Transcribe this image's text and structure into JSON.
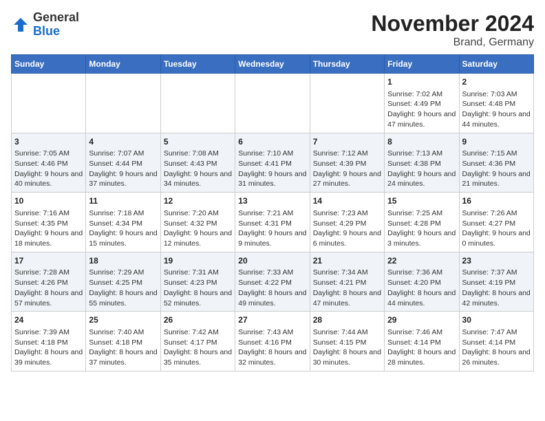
{
  "app": {
    "logo_general": "General",
    "logo_blue": "Blue"
  },
  "header": {
    "title": "November 2024",
    "subtitle": "Brand, Germany"
  },
  "weekdays": [
    "Sunday",
    "Monday",
    "Tuesday",
    "Wednesday",
    "Thursday",
    "Friday",
    "Saturday"
  ],
  "weeks": [
    [
      {
        "day": "",
        "info": ""
      },
      {
        "day": "",
        "info": ""
      },
      {
        "day": "",
        "info": ""
      },
      {
        "day": "",
        "info": ""
      },
      {
        "day": "",
        "info": ""
      },
      {
        "day": "1",
        "info": "Sunrise: 7:02 AM\nSunset: 4:49 PM\nDaylight: 9 hours and 47 minutes."
      },
      {
        "day": "2",
        "info": "Sunrise: 7:03 AM\nSunset: 4:48 PM\nDaylight: 9 hours and 44 minutes."
      }
    ],
    [
      {
        "day": "3",
        "info": "Sunrise: 7:05 AM\nSunset: 4:46 PM\nDaylight: 9 hours and 40 minutes."
      },
      {
        "day": "4",
        "info": "Sunrise: 7:07 AM\nSunset: 4:44 PM\nDaylight: 9 hours and 37 minutes."
      },
      {
        "day": "5",
        "info": "Sunrise: 7:08 AM\nSunset: 4:43 PM\nDaylight: 9 hours and 34 minutes."
      },
      {
        "day": "6",
        "info": "Sunrise: 7:10 AM\nSunset: 4:41 PM\nDaylight: 9 hours and 31 minutes."
      },
      {
        "day": "7",
        "info": "Sunrise: 7:12 AM\nSunset: 4:39 PM\nDaylight: 9 hours and 27 minutes."
      },
      {
        "day": "8",
        "info": "Sunrise: 7:13 AM\nSunset: 4:38 PM\nDaylight: 9 hours and 24 minutes."
      },
      {
        "day": "9",
        "info": "Sunrise: 7:15 AM\nSunset: 4:36 PM\nDaylight: 9 hours and 21 minutes."
      }
    ],
    [
      {
        "day": "10",
        "info": "Sunrise: 7:16 AM\nSunset: 4:35 PM\nDaylight: 9 hours and 18 minutes."
      },
      {
        "day": "11",
        "info": "Sunrise: 7:18 AM\nSunset: 4:34 PM\nDaylight: 9 hours and 15 minutes."
      },
      {
        "day": "12",
        "info": "Sunrise: 7:20 AM\nSunset: 4:32 PM\nDaylight: 9 hours and 12 minutes."
      },
      {
        "day": "13",
        "info": "Sunrise: 7:21 AM\nSunset: 4:31 PM\nDaylight: 9 hours and 9 minutes."
      },
      {
        "day": "14",
        "info": "Sunrise: 7:23 AM\nSunset: 4:29 PM\nDaylight: 9 hours and 6 minutes."
      },
      {
        "day": "15",
        "info": "Sunrise: 7:25 AM\nSunset: 4:28 PM\nDaylight: 9 hours and 3 minutes."
      },
      {
        "day": "16",
        "info": "Sunrise: 7:26 AM\nSunset: 4:27 PM\nDaylight: 9 hours and 0 minutes."
      }
    ],
    [
      {
        "day": "17",
        "info": "Sunrise: 7:28 AM\nSunset: 4:26 PM\nDaylight: 8 hours and 57 minutes."
      },
      {
        "day": "18",
        "info": "Sunrise: 7:29 AM\nSunset: 4:25 PM\nDaylight: 8 hours and 55 minutes."
      },
      {
        "day": "19",
        "info": "Sunrise: 7:31 AM\nSunset: 4:23 PM\nDaylight: 8 hours and 52 minutes."
      },
      {
        "day": "20",
        "info": "Sunrise: 7:33 AM\nSunset: 4:22 PM\nDaylight: 8 hours and 49 minutes."
      },
      {
        "day": "21",
        "info": "Sunrise: 7:34 AM\nSunset: 4:21 PM\nDaylight: 8 hours and 47 minutes."
      },
      {
        "day": "22",
        "info": "Sunrise: 7:36 AM\nSunset: 4:20 PM\nDaylight: 8 hours and 44 minutes."
      },
      {
        "day": "23",
        "info": "Sunrise: 7:37 AM\nSunset: 4:19 PM\nDaylight: 8 hours and 42 minutes."
      }
    ],
    [
      {
        "day": "24",
        "info": "Sunrise: 7:39 AM\nSunset: 4:18 PM\nDaylight: 8 hours and 39 minutes."
      },
      {
        "day": "25",
        "info": "Sunrise: 7:40 AM\nSunset: 4:18 PM\nDaylight: 8 hours and 37 minutes."
      },
      {
        "day": "26",
        "info": "Sunrise: 7:42 AM\nSunset: 4:17 PM\nDaylight: 8 hours and 35 minutes."
      },
      {
        "day": "27",
        "info": "Sunrise: 7:43 AM\nSunset: 4:16 PM\nDaylight: 8 hours and 32 minutes."
      },
      {
        "day": "28",
        "info": "Sunrise: 7:44 AM\nSunset: 4:15 PM\nDaylight: 8 hours and 30 minutes."
      },
      {
        "day": "29",
        "info": "Sunrise: 7:46 AM\nSunset: 4:14 PM\nDaylight: 8 hours and 28 minutes."
      },
      {
        "day": "30",
        "info": "Sunrise: 7:47 AM\nSunset: 4:14 PM\nDaylight: 8 hours and 26 minutes."
      }
    ]
  ]
}
